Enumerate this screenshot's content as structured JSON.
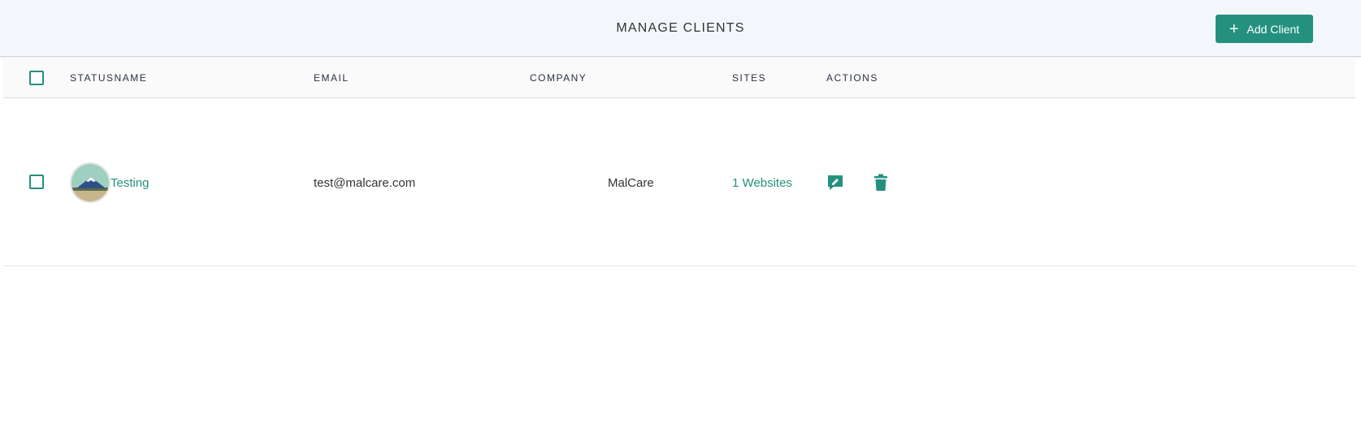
{
  "header": {
    "title": "MANAGE CLIENTS",
    "add_button_label": "Add Client",
    "add_button_icon": "plus-icon"
  },
  "table": {
    "columns": [
      "STATUSNAME",
      "EMAIL",
      "COMPANY",
      "SITES",
      "ACTIONS"
    ],
    "rows": [
      {
        "name": "Testing",
        "email": "test@malcare.com",
        "company": "MalCare",
        "sites": "1 Websites",
        "avatar_icon": "mountain-avatar-icon",
        "actions": [
          "edit-message-icon",
          "trash-icon"
        ]
      }
    ]
  },
  "colors": {
    "accent": "#24917e",
    "header_bg": "#f3f7fc",
    "table_header_bg": "#fafafa"
  }
}
